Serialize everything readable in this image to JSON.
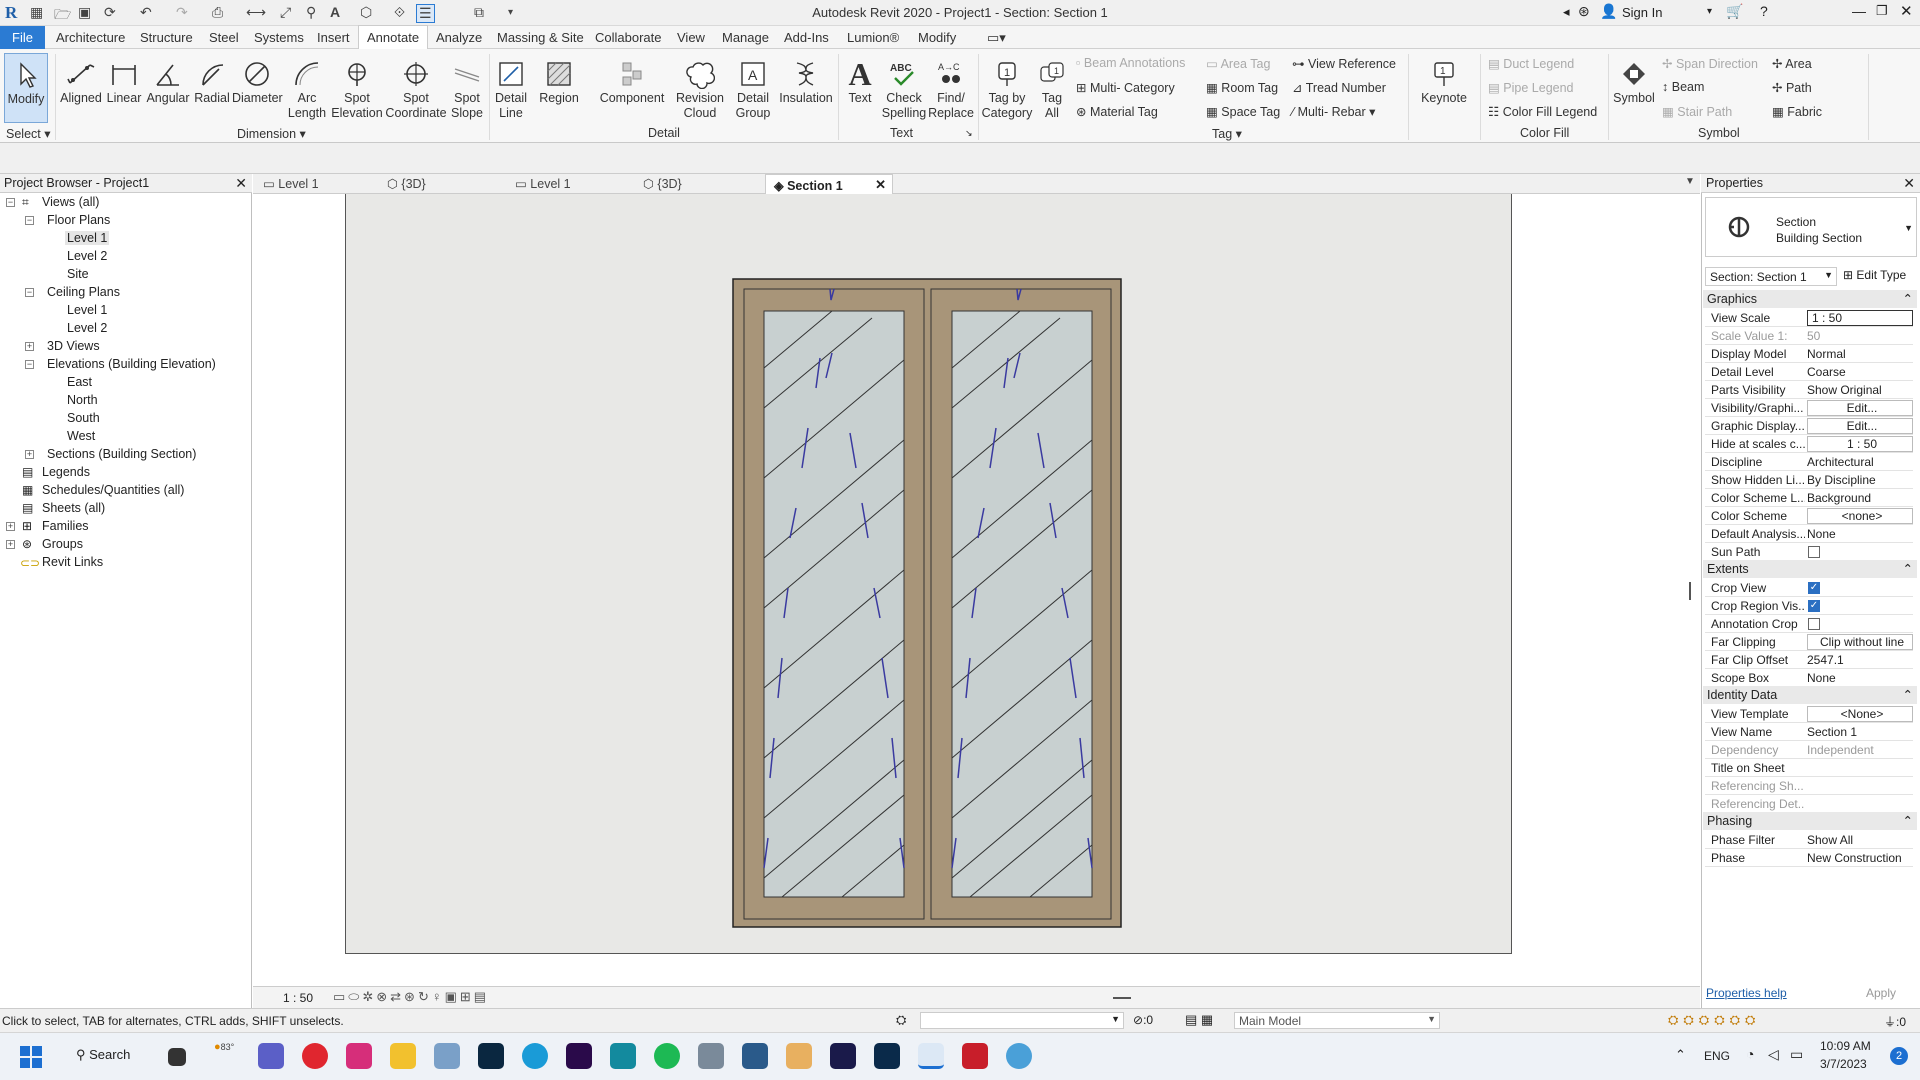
{
  "window": {
    "title": "Autodesk Revit 2020 - Project1 - Section: Section 1",
    "sign_in": "Sign In"
  },
  "menu": [
    "File",
    "Architecture",
    "Structure",
    "Steel",
    "Systems",
    "Insert",
    "Annotate",
    "Analyze",
    "Massing & Site",
    "Collaborate",
    "View",
    "Manage",
    "Add-Ins",
    "Lumion®",
    "Modify"
  ],
  "ribbon": {
    "modify": "Modify",
    "dimension": [
      "Aligned",
      "Linear",
      "Angular",
      "Radial",
      "Diameter",
      "Arc Length",
      "Spot Elevation",
      "Spot Coordinate",
      "Spot Slope"
    ],
    "detail": [
      "Detail Line",
      "Region",
      "Component",
      "Revision Cloud",
      "Detail Group",
      "Insulation"
    ],
    "text": [
      "Text",
      "Check Spelling",
      "Find/ Replace"
    ],
    "tag_big": [
      "Tag by Category",
      "Tag All"
    ],
    "tag_small": [
      "Beam Annotations",
      "Multi- Category",
      "Material Tag",
      "Area Tag",
      "Room Tag",
      "Space Tag",
      "View Reference",
      "Tread Number",
      "Multi- Rebar"
    ],
    "keynote": "Keynote",
    "color_fill": [
      "Duct Legend",
      "Pipe Legend",
      "Color Fill Legend"
    ],
    "symbol_big": "Symbol",
    "symbol_small": [
      "Span Direction",
      "Beam",
      "Stair Path",
      "Area",
      "Path",
      "Fabric"
    ],
    "panels": {
      "select": "Select ▾",
      "dimension": "Dimension ▾",
      "detail": "Detail",
      "text": "Text",
      "tag": "Tag ▾",
      "color_fill": "Color Fill",
      "symbol": "Symbol"
    }
  },
  "project_browser": {
    "title": "Project Browser - Project1",
    "items": [
      "Views (all)",
      "Floor Plans",
      "Level 1",
      "Level 2",
      "Site",
      "Ceiling Plans",
      "Level 1",
      "Level 2",
      "3D Views",
      "Elevations (Building Elevation)",
      "East",
      "North",
      "South",
      "West",
      "Sections (Building Section)",
      "Legends",
      "Schedules/Quantities (all)",
      "Sheets (all)",
      "Families",
      "Groups",
      "Revit Links"
    ]
  },
  "view_tabs": [
    "Level 1",
    "{3D}",
    "Level 1",
    "{3D}",
    "Section 1"
  ],
  "view_scale": "1 : 50",
  "properties": {
    "title": "Properties",
    "type_line1": "Section",
    "type_line2": "Building Section",
    "selector": "Section: Section 1",
    "edit_type": "Edit Type",
    "groups": {
      "graphics": "Graphics",
      "extents": "Extents",
      "identity": "Identity Data",
      "phasing": "Phasing"
    },
    "graphics": [
      {
        "k": "View Scale",
        "v": "1 : 50"
      },
      {
        "k": "Scale Value    1:",
        "v": "50"
      },
      {
        "k": "Display Model",
        "v": "Normal"
      },
      {
        "k": "Detail Level",
        "v": "Coarse"
      },
      {
        "k": "Parts Visibility",
        "v": "Show Original"
      },
      {
        "k": "Visibility/Graphi...",
        "v": "Edit..."
      },
      {
        "k": "Graphic Display...",
        "v": "Edit..."
      },
      {
        "k": "Hide at scales c...",
        "v": "1 : 50"
      },
      {
        "k": "Discipline",
        "v": "Architectural"
      },
      {
        "k": "Show Hidden Li...",
        "v": "By Discipline"
      },
      {
        "k": "Color Scheme L...",
        "v": "Background"
      },
      {
        "k": "Color Scheme",
        "v": "<none>"
      },
      {
        "k": "Default Analysis...",
        "v": "None"
      },
      {
        "k": "Sun Path",
        "v": ""
      }
    ],
    "extents": [
      {
        "k": "Crop View",
        "v": ""
      },
      {
        "k": "Crop Region Vis...",
        "v": ""
      },
      {
        "k": "Annotation Crop",
        "v": ""
      },
      {
        "k": "Far Clipping",
        "v": "Clip without line"
      },
      {
        "k": "Far Clip Offset",
        "v": "2547.1"
      },
      {
        "k": "Scope Box",
        "v": "None"
      }
    ],
    "identity": [
      {
        "k": "View Template",
        "v": "<None>"
      },
      {
        "k": "View Name",
        "v": "Section 1"
      },
      {
        "k": "Dependency",
        "v": "Independent"
      },
      {
        "k": "Title on Sheet",
        "v": ""
      },
      {
        "k": "Referencing Sh...",
        "v": ""
      },
      {
        "k": "Referencing Det...",
        "v": ""
      }
    ],
    "phasing": [
      {
        "k": "Phase Filter",
        "v": "Show All"
      },
      {
        "k": "Phase",
        "v": "New Construction"
      }
    ],
    "help": "Properties help",
    "apply": "Apply"
  },
  "status": {
    "hint": "Click to select, TAB for alternates, CTRL adds, SHIFT unselects.",
    "count": ":0",
    "model": "Main Model",
    "filter": ":0"
  },
  "taskbar": {
    "search": "Search",
    "weather": "83°",
    "lang": "ENG",
    "time": "10:09 AM",
    "date": "3/7/2023",
    "badge": "2"
  },
  "colors": {
    "accent": "#2b7bd3",
    "frame": "#a89579",
    "glass": "#c8d0d0",
    "view_bg": "#e8e8e6"
  }
}
